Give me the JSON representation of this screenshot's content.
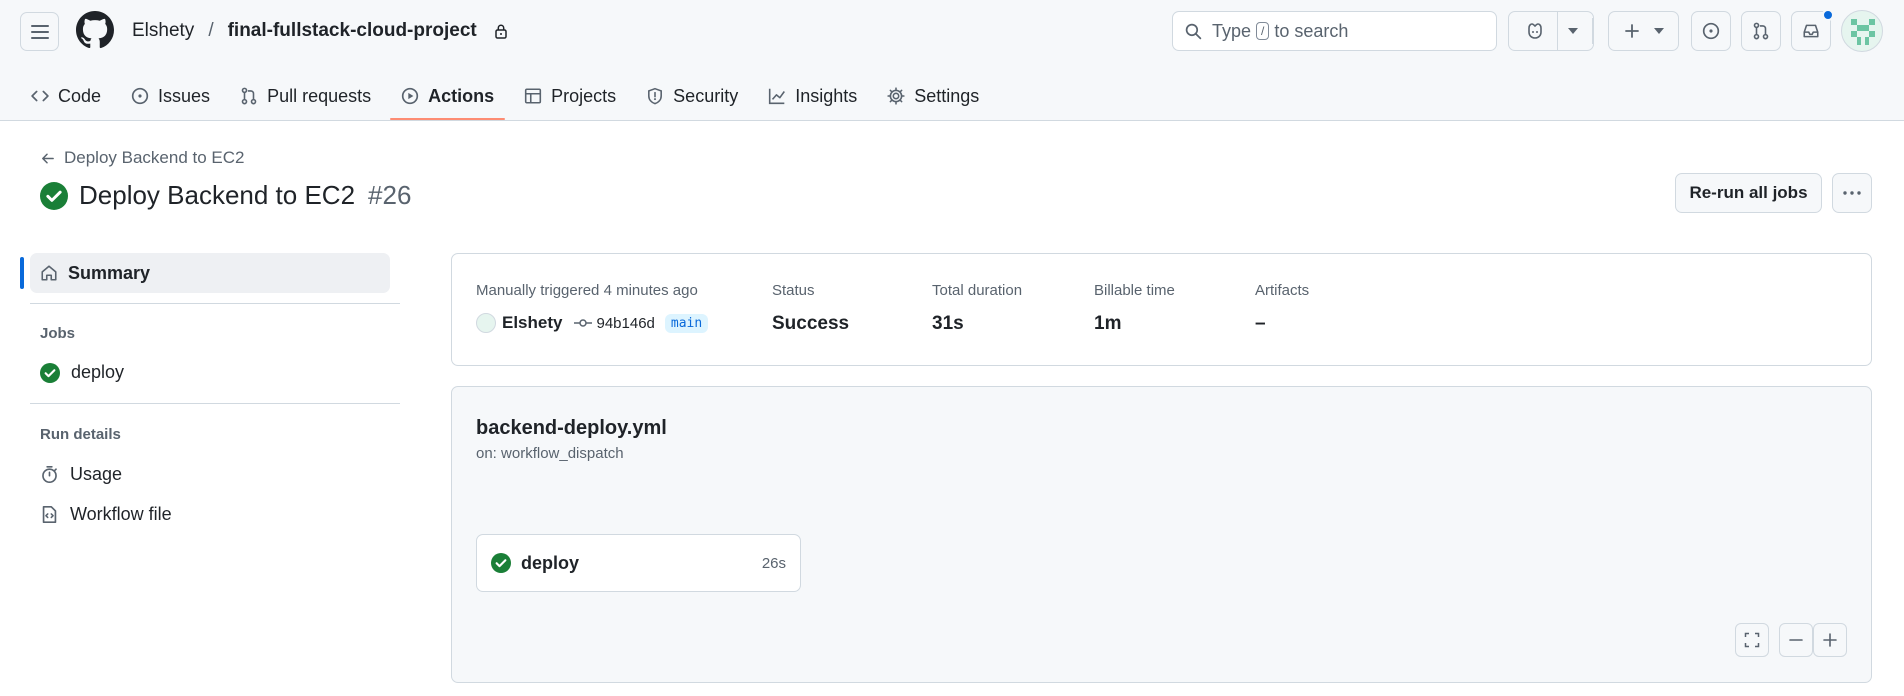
{
  "header": {
    "owner": "Elshety",
    "separator": "/",
    "repo": "final-fullstack-cloud-project",
    "search_pre": "Type",
    "search_key": "/",
    "search_post": "to search"
  },
  "tabs": [
    {
      "label": "Code",
      "icon": "code-icon"
    },
    {
      "label": "Issues",
      "icon": "issue-icon"
    },
    {
      "label": "Pull requests",
      "icon": "pull-request-icon"
    },
    {
      "label": "Actions",
      "icon": "play-icon",
      "active": true
    },
    {
      "label": "Projects",
      "icon": "table-icon"
    },
    {
      "label": "Security",
      "icon": "shield-icon"
    },
    {
      "label": "Insights",
      "icon": "graph-icon"
    },
    {
      "label": "Settings",
      "icon": "gear-icon"
    }
  ],
  "run": {
    "back_label": "Deploy Backend to EC2",
    "title": "Deploy Backend to EC2",
    "number": "#26",
    "rerun_label": "Re-run all jobs"
  },
  "sidebar": {
    "summary": "Summary",
    "jobs_heading": "Jobs",
    "job_deploy": "deploy",
    "run_details_heading": "Run details",
    "usage": "Usage",
    "workflow_file": "Workflow file"
  },
  "summary": {
    "trigger_label": "Manually triggered 4 minutes ago",
    "actor": "Elshety",
    "sha": "94b146d",
    "branch": "main",
    "status_label": "Status",
    "status_value": "Success",
    "duration_label": "Total duration",
    "duration_value": "31s",
    "billable_label": "Billable time",
    "billable_value": "1m",
    "artifacts_label": "Artifacts",
    "artifacts_value": "–"
  },
  "graph": {
    "workflow_file": "backend-deploy.yml",
    "trigger": "on: workflow_dispatch",
    "job_name": "deploy",
    "job_duration": "26s"
  },
  "colors": {
    "success": "#1a7f37",
    "accent": "#0969da",
    "active_tab": "#fd8c73"
  }
}
